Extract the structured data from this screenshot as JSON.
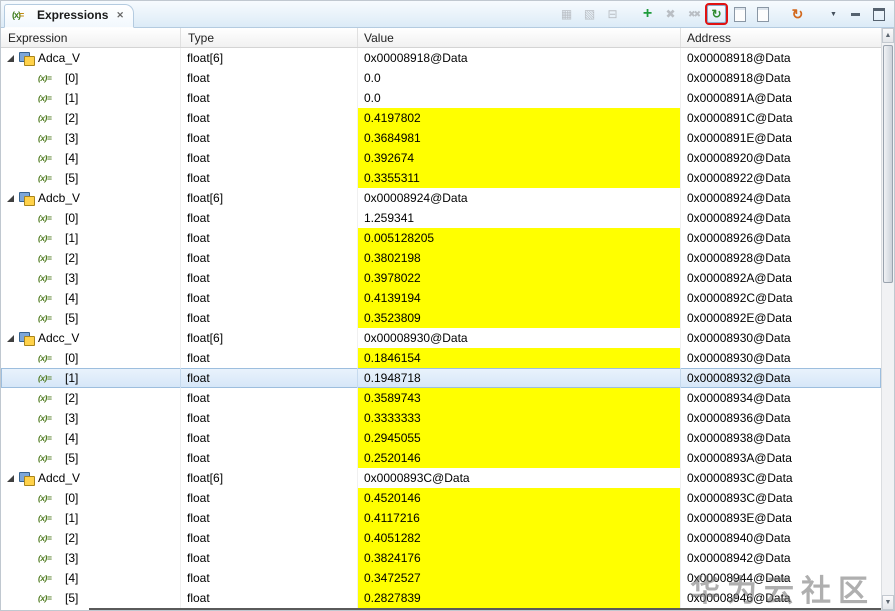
{
  "tab": {
    "title": "Expressions",
    "close_glyph": "✕"
  },
  "columns": [
    "Expression",
    "Type",
    "Value",
    "Address"
  ],
  "icons": {
    "variable_glyph": "(x)="
  },
  "colors": {
    "value_highlight": "#ffff00",
    "selection": "#d5e6f8",
    "annotation_box": "#e01212"
  },
  "toolbar": {
    "items": [
      {
        "name": "show-type-names-icon",
        "glyph": "▦",
        "enabled": false
      },
      {
        "name": "show-logical-structure-icon",
        "glyph": "▧",
        "enabled": false
      },
      {
        "name": "collapse-all-icon",
        "glyph": "⊟",
        "enabled": false
      },
      {
        "type": "separator"
      },
      {
        "name": "add-expression-icon",
        "glyph": "+",
        "enabled": true,
        "color": "#1e9c3c",
        "bold": true,
        "size": 16
      },
      {
        "name": "remove-expression-icon",
        "glyph": "✖",
        "enabled": false
      },
      {
        "name": "remove-all-expressions-icon",
        "glyph": "✖✖",
        "enabled": false,
        "size": 9
      },
      {
        "name": "continuous-refresh-icon",
        "glyph": "↻",
        "enabled": true,
        "color": "#2e8b2e",
        "bold": true,
        "highlighted": true
      },
      {
        "name": "export-expressions-icon",
        "shape": "page",
        "enabled": true
      },
      {
        "name": "import-expressions-icon",
        "shape": "page",
        "enabled": true
      },
      {
        "type": "separator"
      },
      {
        "name": "refresh-icon",
        "glyph": "↻",
        "enabled": true,
        "color": "#d2691e",
        "bold": true,
        "size": 14
      },
      {
        "type": "separator"
      },
      {
        "name": "view-menu-icon",
        "glyph": "▼",
        "enabled": true,
        "size": 7,
        "color": "#44505c"
      },
      {
        "name": "minimize-icon",
        "shape": "minbar",
        "enabled": true
      },
      {
        "name": "maximize-icon",
        "shape": "maxbox",
        "enabled": true
      }
    ]
  },
  "rows": [
    {
      "level": 0,
      "expanded": true,
      "name": "Adca_V",
      "type": "float[6]",
      "value": "0x00008918@Data",
      "address": "0x00008918@Data",
      "value_highlight": false
    },
    {
      "level": 1,
      "name": "[0]",
      "type": "float",
      "value": "0.0",
      "address": "0x00008918@Data",
      "value_highlight": false
    },
    {
      "level": 1,
      "name": "[1]",
      "type": "float",
      "value": "0.0",
      "address": "0x0000891A@Data",
      "value_highlight": false
    },
    {
      "level": 1,
      "name": "[2]",
      "type": "float",
      "value": "0.4197802",
      "address": "0x0000891C@Data",
      "value_highlight": true
    },
    {
      "level": 1,
      "name": "[3]",
      "type": "float",
      "value": "0.3684981",
      "address": "0x0000891E@Data",
      "value_highlight": true
    },
    {
      "level": 1,
      "name": "[4]",
      "type": "float",
      "value": "0.392674",
      "address": "0x00008920@Data",
      "value_highlight": true
    },
    {
      "level": 1,
      "name": "[5]",
      "type": "float",
      "value": "0.3355311",
      "address": "0x00008922@Data",
      "value_highlight": true
    },
    {
      "level": 0,
      "expanded": true,
      "name": "Adcb_V",
      "type": "float[6]",
      "value": "0x00008924@Data",
      "address": "0x00008924@Data",
      "value_highlight": false
    },
    {
      "level": 1,
      "name": "[0]",
      "type": "float",
      "value": "1.259341",
      "address": "0x00008924@Data",
      "value_highlight": false
    },
    {
      "level": 1,
      "name": "[1]",
      "type": "float",
      "value": "0.005128205",
      "address": "0x00008926@Data",
      "value_highlight": true
    },
    {
      "level": 1,
      "name": "[2]",
      "type": "float",
      "value": "0.3802198",
      "address": "0x00008928@Data",
      "value_highlight": true
    },
    {
      "level": 1,
      "name": "[3]",
      "type": "float",
      "value": "0.3978022",
      "address": "0x0000892A@Data",
      "value_highlight": true
    },
    {
      "level": 1,
      "name": "[4]",
      "type": "float",
      "value": "0.4139194",
      "address": "0x0000892C@Data",
      "value_highlight": true
    },
    {
      "level": 1,
      "name": "[5]",
      "type": "float",
      "value": "0.3523809",
      "address": "0x0000892E@Data",
      "value_highlight": true
    },
    {
      "level": 0,
      "expanded": true,
      "name": "Adcc_V",
      "type": "float[6]",
      "value": "0x00008930@Data",
      "address": "0x00008930@Data",
      "value_highlight": false
    },
    {
      "level": 1,
      "name": "[0]",
      "type": "float",
      "value": "0.1846154",
      "address": "0x00008930@Data",
      "value_highlight": true
    },
    {
      "level": 1,
      "name": "[1]",
      "type": "float",
      "value": "0.1948718",
      "address": "0x00008932@Data",
      "value_highlight": false,
      "selected": true
    },
    {
      "level": 1,
      "name": "[2]",
      "type": "float",
      "value": "0.3589743",
      "address": "0x00008934@Data",
      "value_highlight": true
    },
    {
      "level": 1,
      "name": "[3]",
      "type": "float",
      "value": "0.3333333",
      "address": "0x00008936@Data",
      "value_highlight": true
    },
    {
      "level": 1,
      "name": "[4]",
      "type": "float",
      "value": "0.2945055",
      "address": "0x00008938@Data",
      "value_highlight": true
    },
    {
      "level": 1,
      "name": "[5]",
      "type": "float",
      "value": "0.2520146",
      "address": "0x0000893A@Data",
      "value_highlight": true
    },
    {
      "level": 0,
      "expanded": true,
      "name": "Adcd_V",
      "type": "float[6]",
      "value": "0x0000893C@Data",
      "address": "0x0000893C@Data",
      "value_highlight": false
    },
    {
      "level": 1,
      "name": "[0]",
      "type": "float",
      "value": "0.4520146",
      "address": "0x0000893C@Data",
      "value_highlight": true
    },
    {
      "level": 1,
      "name": "[1]",
      "type": "float",
      "value": "0.4117216",
      "address": "0x0000893E@Data",
      "value_highlight": true
    },
    {
      "level": 1,
      "name": "[2]",
      "type": "float",
      "value": "0.4051282",
      "address": "0x00008940@Data",
      "value_highlight": true
    },
    {
      "level": 1,
      "name": "[3]",
      "type": "float",
      "value": "0.3824176",
      "address": "0x00008942@Data",
      "value_highlight": true
    },
    {
      "level": 1,
      "name": "[4]",
      "type": "float",
      "value": "0.3472527",
      "address": "0x00008944@Data",
      "value_highlight": true
    },
    {
      "level": 1,
      "name": "[5]",
      "type": "float",
      "value": "0.2827839",
      "address": "0x00008946@Data",
      "value_highlight": true
    }
  ],
  "watermark": {
    "text": "华为云社区"
  }
}
